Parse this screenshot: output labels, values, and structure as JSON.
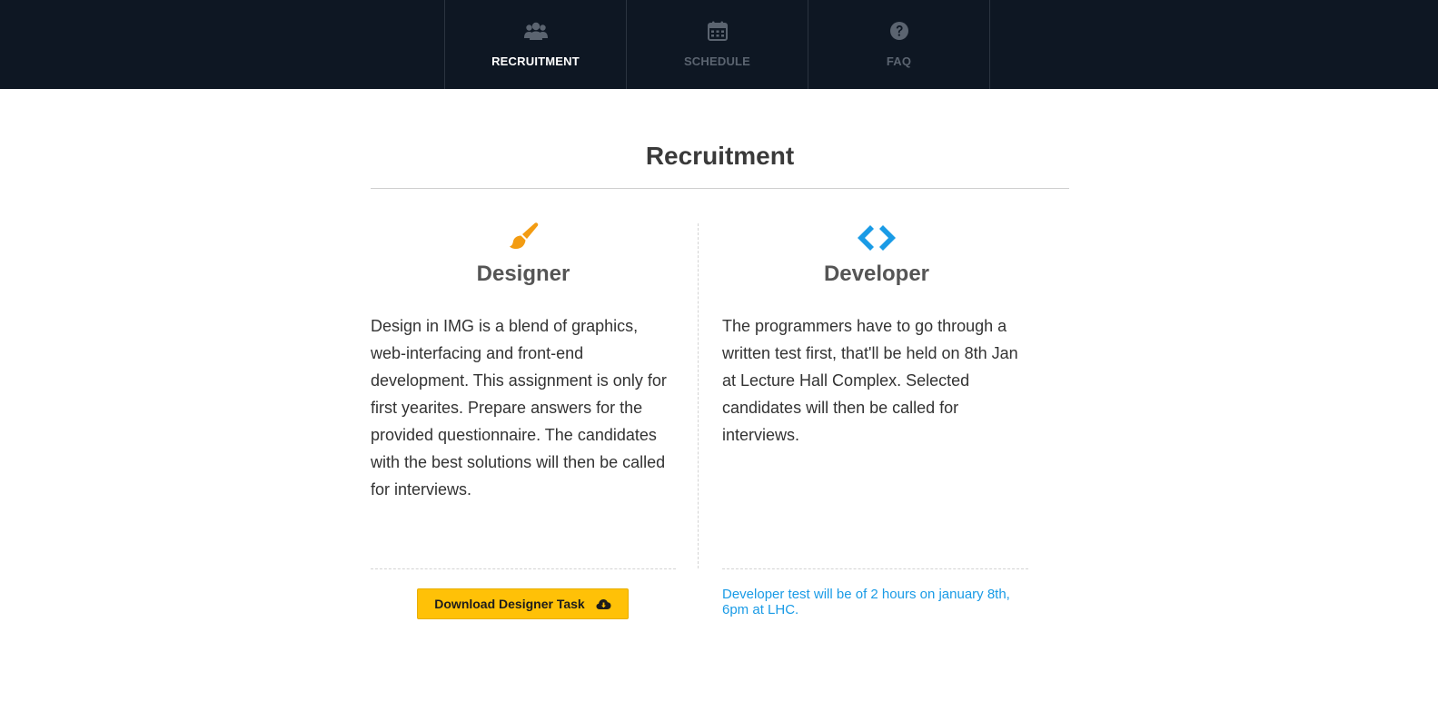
{
  "nav": {
    "items": [
      {
        "label": "RECRUITMENT",
        "icon": "users-icon",
        "active": true
      },
      {
        "label": "SCHEDULE",
        "icon": "calendar-icon",
        "active": false
      },
      {
        "label": "FAQ",
        "icon": "question-circle-icon",
        "active": false
      }
    ]
  },
  "page": {
    "title": "Recruitment"
  },
  "designer": {
    "icon": "paintbrush-icon",
    "title": "Designer",
    "text": "Design in IMG is a blend of graphics, web-interfacing and front-end development. This assignment is only for first yearites. Prepare answers for the provided questionnaire. The candidates with the best solutions will then be called for interviews.",
    "button_label": "Download Designer Task",
    "button_icon": "cloud-download-icon"
  },
  "developer": {
    "icon": "code-icon",
    "title": "Developer",
    "text": "The programmers have to go through a written test first, that'll be held on 8th Jan at Lecture Hall Complex. Selected candidates will then be called for interviews.",
    "note": "Developer test will be of 2 hours on january 8th, 6pm at LHC."
  },
  "colors": {
    "topbar": "#0e1723",
    "accent_orange": "#f39c12",
    "accent_blue": "#1a9be6",
    "button_yellow": "#ffc107"
  }
}
